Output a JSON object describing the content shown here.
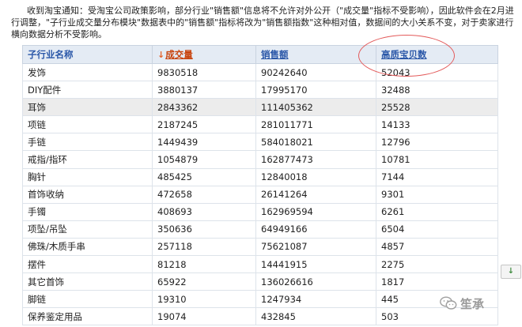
{
  "notice": "收到淘宝通知：受淘宝公司政策影响，部分行业\"销售额\"信息将不允许对外公开（\"成交量\"指标不受影响），因此软件会在2月进行调整，\"子行业成交量分布模块\"数据表中的\"销售额\"指标将改为\"销售额指数\"这种相对值，数据间的大小关系不变，对于卖家进行横向数据分析不受影响。",
  "table": {
    "headers": {
      "name": "子行业名称",
      "sort_arrow": "↓",
      "volume": "成交量",
      "sales": "销售额",
      "quality": "高质宝贝数"
    },
    "rows": [
      {
        "name": "发饰",
        "volume": "9830518",
        "sales": "90242640",
        "quality": "52043"
      },
      {
        "name": "DIY配件",
        "volume": "3880137",
        "sales": "17995170",
        "quality": "32488"
      },
      {
        "name": "耳饰",
        "volume": "2843362",
        "sales": "111405362",
        "quality": "25528"
      },
      {
        "name": "项链",
        "volume": "2187245",
        "sales": "281011771",
        "quality": "14133"
      },
      {
        "name": "手链",
        "volume": "1449439",
        "sales": "584018021",
        "quality": "12796"
      },
      {
        "name": "戒指/指环",
        "volume": "1054879",
        "sales": "162877473",
        "quality": "10781"
      },
      {
        "name": "胸针",
        "volume": "485425",
        "sales": "12840018",
        "quality": "7144"
      },
      {
        "name": "首饰收纳",
        "volume": "472658",
        "sales": "26141264",
        "quality": "9301"
      },
      {
        "name": "手镯",
        "volume": "408693",
        "sales": "162969594",
        "quality": "6261"
      },
      {
        "name": "项坠/吊坠",
        "volume": "350636",
        "sales": "64949166",
        "quality": "6504"
      },
      {
        "name": "佛珠/木质手串",
        "volume": "257118",
        "sales": "75621087",
        "quality": "4857"
      },
      {
        "name": "摆件",
        "volume": "81218",
        "sales": "14441915",
        "quality": "2275"
      },
      {
        "name": "其它首饰",
        "volume": "65922",
        "sales": "136026616",
        "quality": "1817"
      },
      {
        "name": "脚链",
        "volume": "19310",
        "sales": "1247934",
        "quality": "445"
      },
      {
        "name": "保养鉴定用品",
        "volume": "19074",
        "sales": "432845",
        "quality": "503"
      }
    ]
  },
  "scroll_button": {
    "icon": "arrow-down-icon",
    "label": "↓"
  },
  "watermark": {
    "text": "笙承",
    "icon": "wechat-icon"
  },
  "colors": {
    "header_bg": "#e4ebf4",
    "header_text": "#2a57a8",
    "sort_accent": "#e4622b",
    "circle": "#e35a5a"
  }
}
